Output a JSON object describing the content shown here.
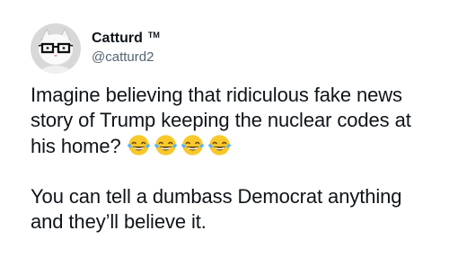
{
  "tweet": {
    "author": {
      "display_name": "Catturd",
      "badge": "TM",
      "handle": "@catturd2"
    },
    "text": {
      "line1": "Imagine believing that ridiculous fake news story of Trump keeping the nuclear codes at his home?",
      "line2": "You can tell a dumbass Democrat anything and they’ll believe it."
    },
    "emojis": [
      "face-with-tears-of-joy",
      "face-with-tears-of-joy",
      "face-with-tears-of-joy",
      "face-with-tears-of-joy"
    ],
    "colors": {
      "text": "#0f1419",
      "secondary": "#536471",
      "emoji_face": "#f9c82b",
      "emoji_tears": "#5bb4f5"
    }
  }
}
